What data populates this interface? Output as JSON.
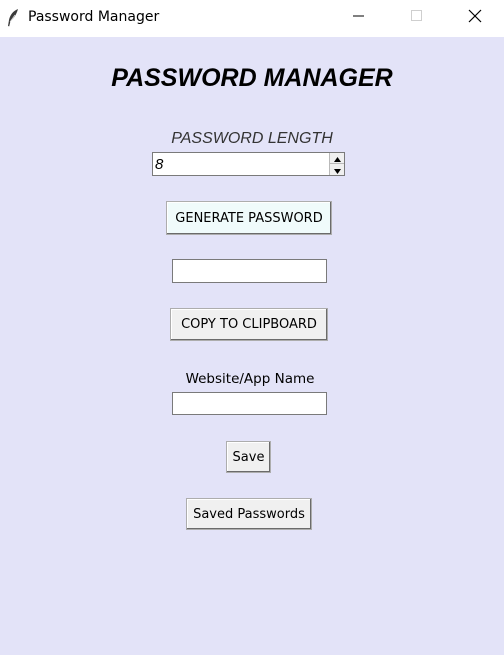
{
  "window": {
    "title": "Password Manager",
    "app_icon": "feather-icon",
    "background_color": "#e3e3f8",
    "controls": {
      "minimize_icon": "minimize-icon",
      "maximize_icon": "maximize-icon",
      "close_icon": "close-icon"
    }
  },
  "main": {
    "heading": "PASSWORD MANAGER",
    "length_label": "PASSWORD LENGTH",
    "length_value": "8",
    "generate_button": "GENERATE PASSWORD",
    "generate_button_color": "#f0fbfb",
    "password_value": "",
    "copy_button": "COPY TO CLIPBOARD",
    "website_label": "Website/App Name",
    "website_value": "",
    "save_button": "Save",
    "saved_passwords_button": "Saved Passwords"
  }
}
